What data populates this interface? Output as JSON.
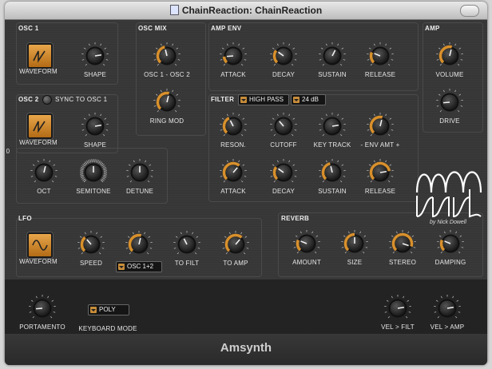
{
  "window": {
    "title": "ChainReaction: ChainReaction"
  },
  "sections": {
    "osc1": "OSC 1",
    "osc_mix": "OSC MIX",
    "amp_env": "AMP ENV",
    "amp": "AMP",
    "osc2": "OSC 2",
    "sync": "SYNC TO OSC 1",
    "filter": "FILTER",
    "lfo": "LFO",
    "reverb": "REVERB"
  },
  "labels": {
    "osc1_waveform": "WAVEFORM",
    "osc1_shape": "SHAPE",
    "osc_mix": "OSC 1 - OSC 2",
    "ring_mod": "RING MOD",
    "amp_attack": "ATTACK",
    "amp_decay": "DECAY",
    "amp_sustain": "SUSTAIN",
    "amp_release": "RELEASE",
    "volume": "VOLUME",
    "drive": "DRIVE",
    "osc2_waveform": "WAVEFORM",
    "osc2_shape": "SHAPE",
    "oct_value": "0",
    "oct": "OCT",
    "semitone": "SEMITONE",
    "detune": "DETUNE",
    "reson": "RESON.",
    "cutoff": "CUTOFF",
    "key_track": "KEY TRACK",
    "env_amt": "- ENV AMT +",
    "f_attack": "ATTACK",
    "f_decay": "DECAY",
    "f_sustain": "SUSTAIN",
    "f_release": "RELEASE",
    "lfo_waveform": "WAVEFORM",
    "speed": "SPEED",
    "to_filt": "TO FILT",
    "to_amp": "TO AMP",
    "amount": "AMOUNT",
    "size": "SIZE",
    "stereo": "STEREO",
    "damping": "DAMPING",
    "portamento": "PORTAMENTO",
    "keyboard_mode": "KEYBOARD MODE",
    "vel_filt": "VEL > FILT",
    "vel_amp": "VEL > AMP"
  },
  "dropdowns": {
    "filter_type": "HIGH PASS",
    "filter_slope": "24 dB",
    "lfo_osc": "OSC 1+2",
    "keyboard_mode": "POLY"
  },
  "logo": {
    "text": "AM Synth",
    "by": "by Nick Dowell"
  },
  "brand": "Amsynth",
  "knob_values": {
    "osc1_shape": 0.8,
    "osc_mix": 0.45,
    "ring_mod": 0.55,
    "amp_attack": 0.15,
    "amp_decay": 0.3,
    "amp_sustain": 0.6,
    "amp_release": 0.25,
    "volume": 0.55,
    "drive": 0.15,
    "osc2_shape": 0.8,
    "oct": 0.55,
    "semitone": 0.5,
    "detune": 0.5,
    "reson": 0.4,
    "cutoff": 0.35,
    "key_track": 0.8,
    "env_amt": 0.55,
    "f_attack": 0.65,
    "f_decay": 0.3,
    "f_sustain": 0.45,
    "f_release": 0.8,
    "speed": 0.35,
    "lfo_knob": 0.55,
    "to_filt": 0.4,
    "to_amp": 0.65,
    "amount": 0.25,
    "size": 0.5,
    "stereo": 0.9,
    "damping": 0.25,
    "portamento": 0.15,
    "vel_filt": 0.8,
    "vel_amp": 0.8
  },
  "colors": {
    "accent": "#d8902c",
    "panel": "#383838",
    "bottom": "#232323"
  },
  "icons": {
    "osc1_waveform": "saw-wave-icon",
    "osc2_waveform": "saw-wave-icon",
    "lfo_waveform": "sine-wave-icon"
  }
}
